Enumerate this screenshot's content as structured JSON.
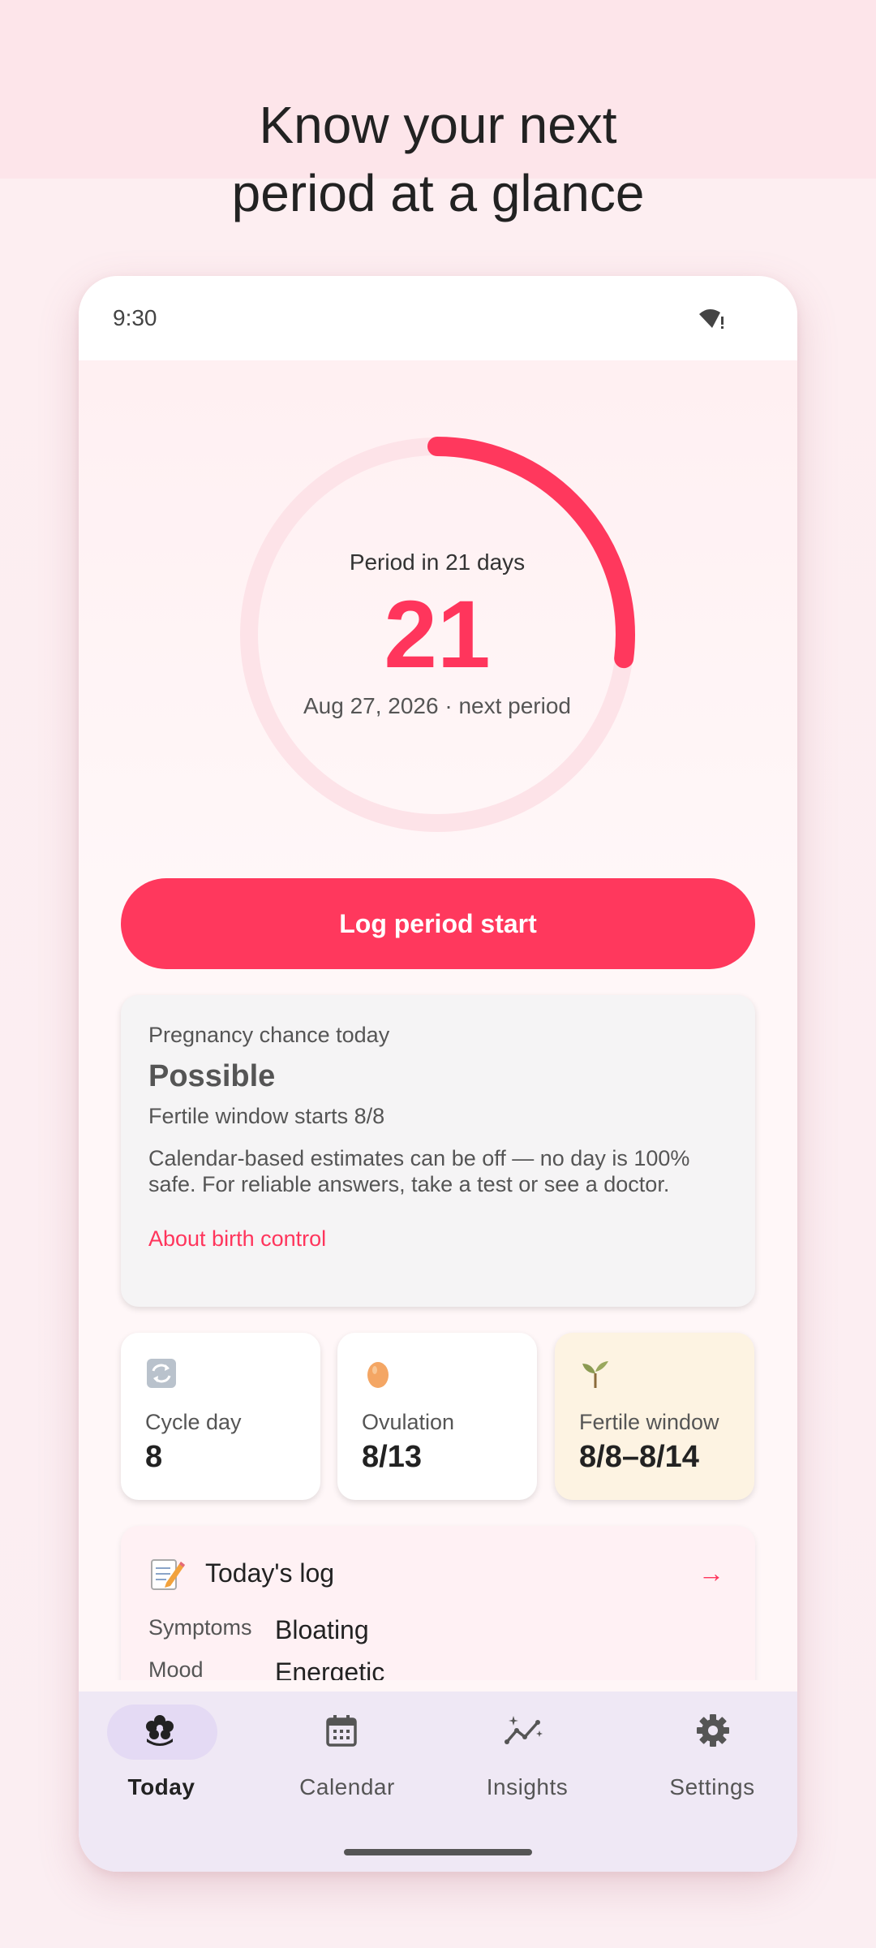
{
  "headline": {
    "line1": "Know your next",
    "line2": "period at a glance"
  },
  "status_bar": {
    "time": "9:30"
  },
  "cycle_ring": {
    "caption": "Period in 21 days",
    "days_number": "21",
    "subtitle": "Aug 27, 2026 · next period",
    "progress_fraction": 0.27
  },
  "log_button": {
    "label": "Log period start"
  },
  "pregnancy_card": {
    "title": "Pregnancy chance today",
    "status": "Possible",
    "fertile_note": "Fertile window starts 8/8",
    "description": "Calendar-based estimates can be off — no day is 100% safe. For reliable answers, take a test or see a doctor.",
    "link": "About birth control"
  },
  "stats": [
    {
      "label": "Cycle day",
      "value": "8",
      "icon": "cycle-arrows-icon"
    },
    {
      "label": "Ovulation",
      "value": "8/13",
      "icon": "egg-icon"
    },
    {
      "label": "Fertile window",
      "value": "8/8–8/14",
      "icon": "seedling-icon"
    }
  ],
  "todays_log": {
    "title": "Today's log",
    "arrow": "→",
    "rows": [
      {
        "label": "Symptoms",
        "value": "Bloating"
      },
      {
        "label": "Mood",
        "value": "Energetic"
      }
    ]
  },
  "bottom_nav": [
    {
      "label": "Today",
      "icon": "flower-icon",
      "active": true
    },
    {
      "label": "Calendar",
      "icon": "calendar-icon",
      "active": false
    },
    {
      "label": "Insights",
      "icon": "insights-icon",
      "active": false
    },
    {
      "label": "Settings",
      "icon": "gear-icon",
      "active": false
    }
  ],
  "colors": {
    "accent": "#ff385d",
    "ring_track": "#fde3e8",
    "fertile_card": "#fdf3e2",
    "nav_bg": "#efe8f5",
    "nav_pill": "#e4daf4"
  }
}
